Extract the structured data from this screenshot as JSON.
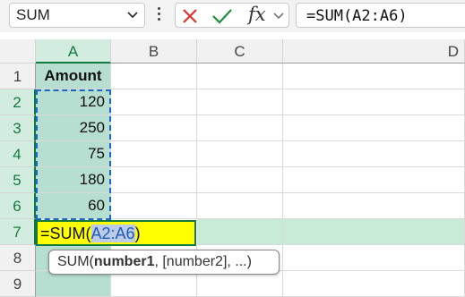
{
  "formula_bar": {
    "name_box": "SUM",
    "fx_label": "fx",
    "formula": "=SUM(A2:A6)"
  },
  "columns": [
    "A",
    "B",
    "C",
    "D"
  ],
  "rows": [
    "1",
    "2",
    "3",
    "4",
    "5",
    "6",
    "7",
    "8",
    "9"
  ],
  "cells": {
    "a1": "Amount",
    "a2": "120",
    "a3": "250",
    "a4": "75",
    "a5": "180",
    "a6": "60"
  },
  "edit": {
    "prefix": "=SUM(",
    "range": "A2:A6",
    "suffix": ")"
  },
  "tooltip": {
    "func": "SUM(",
    "arg1": "number1",
    "rest": ", [number2], ...)"
  },
  "colors": {
    "accent": "#137a3f",
    "selection_fill": "#b7dfd1",
    "active_cell_fill": "#ffff00",
    "range_reference": "#1f5bb8",
    "cancel": "#e0332f",
    "enter": "#1e8e3e"
  },
  "icons": [
    "chevron-down-icon",
    "more-vertical-icon",
    "cancel-icon",
    "enter-check-icon",
    "insert-function-icon"
  ]
}
